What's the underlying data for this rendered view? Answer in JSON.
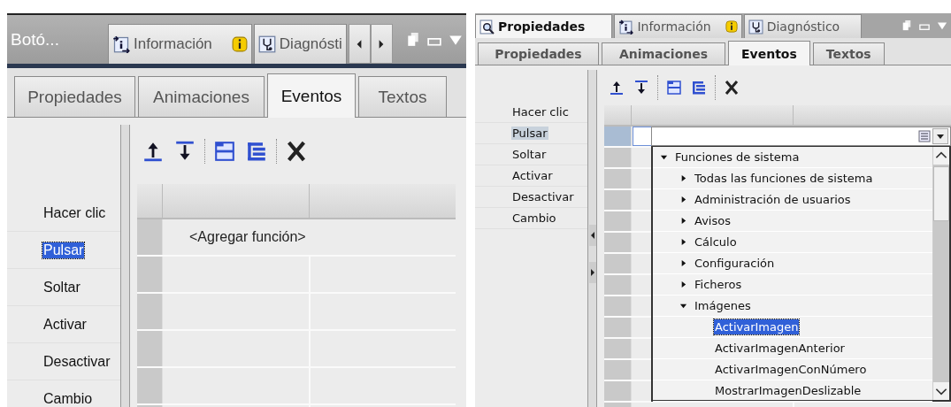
{
  "panels": [
    {
      "title": "Botó...",
      "top_tabs": [
        {
          "label": "Información",
          "kind": "info",
          "info_badge": true,
          "selected": false
        },
        {
          "label": "Diagnósti",
          "kind": "diagnostics",
          "info_badge": false,
          "selected": false
        }
      ],
      "scroll_arrows": true,
      "sub_tabs": [
        {
          "label": "Propiedades",
          "selected": false
        },
        {
          "label": "Animaciones",
          "selected": false
        },
        {
          "label": "Eventos",
          "selected": true
        },
        {
          "label": "Textos",
          "selected": false
        }
      ],
      "events": [
        {
          "label": "Hacer clic",
          "selected": false
        },
        {
          "label": "Pulsar",
          "selected": true
        },
        {
          "label": "Soltar",
          "selected": false
        },
        {
          "label": "Activar",
          "selected": false
        },
        {
          "label": "Desactivar",
          "selected": false
        },
        {
          "label": "Cambio",
          "selected": false
        }
      ],
      "rows": [
        {
          "selected": false,
          "function": "<Agregar función>"
        },
        {
          "selected": false
        },
        {
          "selected": false
        },
        {
          "selected": false
        },
        {
          "selected": false
        },
        {
          "selected": false
        }
      ]
    },
    {
      "top_tabs": [
        {
          "label": "Propiedades",
          "kind": "properties",
          "info_badge": false,
          "selected": true
        },
        {
          "label": "Información",
          "kind": "info",
          "info_badge": true,
          "selected": false
        },
        {
          "label": "Diagnóstico",
          "kind": "diagnostics",
          "info_badge": false,
          "selected": false
        }
      ],
      "scroll_arrows": false,
      "sub_tabs": [
        {
          "label": "Propiedades",
          "selected": false
        },
        {
          "label": "Animaciones",
          "selected": false
        },
        {
          "label": "Eventos",
          "selected": true
        },
        {
          "label": "Textos",
          "selected": false
        }
      ],
      "events": [
        {
          "label": "Hacer clic",
          "selected": false
        },
        {
          "label": "Pulsar",
          "selected": true
        },
        {
          "label": "Soltar",
          "selected": false
        },
        {
          "label": "Activar",
          "selected": false
        },
        {
          "label": "Desactivar",
          "selected": false
        },
        {
          "label": "Cambio",
          "selected": false
        }
      ],
      "rows": [
        {
          "selected": true
        },
        {
          "selected": false
        },
        {
          "selected": false
        },
        {
          "selected": false
        },
        {
          "selected": false
        },
        {
          "selected": false
        },
        {
          "selected": false
        },
        {
          "selected": false
        },
        {
          "selected": false
        },
        {
          "selected": false
        },
        {
          "selected": false
        },
        {
          "selected": false
        },
        {
          "selected": false
        },
        {
          "selected": false
        }
      ],
      "dropdown": {
        "expanded": true,
        "tree": [
          {
            "kind": "folder",
            "label": "Funciones de sistema",
            "expanded": true,
            "children": [
              {
                "kind": "folder",
                "label": "Todas las funciones de sistema",
                "expanded": false
              },
              {
                "kind": "folder",
                "label": "Administración de usuarios",
                "expanded": false
              },
              {
                "kind": "folder",
                "label": "Avisos",
                "expanded": false
              },
              {
                "kind": "folder",
                "label": "Cálculo",
                "expanded": false
              },
              {
                "kind": "folder",
                "label": "Configuración",
                "expanded": false
              },
              {
                "kind": "folder",
                "label": "Ficheros",
                "expanded": false
              },
              {
                "kind": "folder",
                "label": "Imágenes",
                "expanded": true,
                "children": [
                  {
                    "kind": "function",
                    "label": "ActivarImagen",
                    "selected": true
                  },
                  {
                    "kind": "function",
                    "label": "ActivarImagenAnterior",
                    "selected": false
                  },
                  {
                    "kind": "function",
                    "label": "ActivarImagenConNúmero",
                    "selected": false
                  },
                  {
                    "kind": "function",
                    "label": "MostrarImagenDeslizable",
                    "selected": false
                  }
                ]
              }
            ]
          }
        ]
      }
    }
  ]
}
